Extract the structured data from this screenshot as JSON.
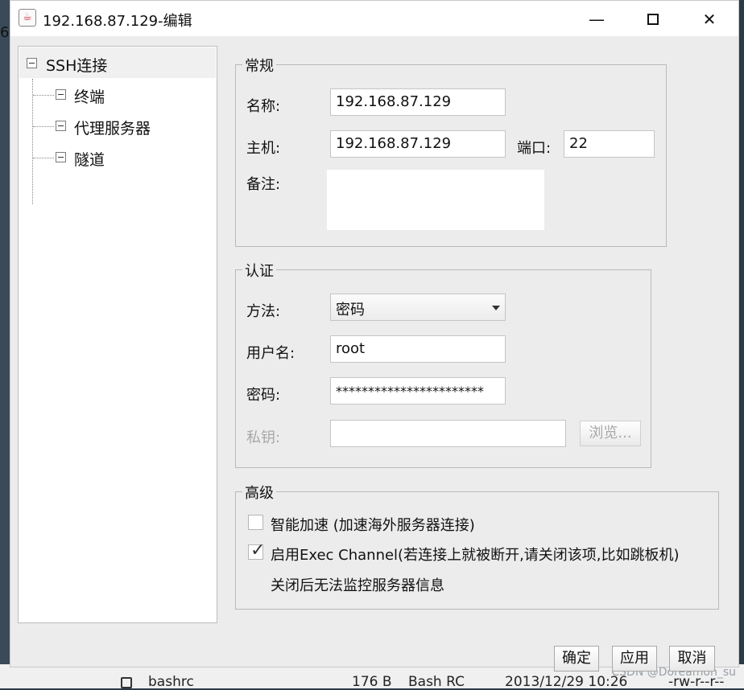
{
  "window": {
    "title": "192.168.87.129-编辑"
  },
  "tree": {
    "root": "SSH连接",
    "children": [
      "终端",
      "代理服务器",
      "隧道"
    ]
  },
  "general": {
    "title": "常规",
    "name_label": "名称:",
    "name_value": "192.168.87.129",
    "host_label": "主机:",
    "host_value": "192.168.87.129",
    "port_label": "端口:",
    "port_value": "22",
    "note_label": "备注:",
    "note_value": ""
  },
  "auth": {
    "title": "认证",
    "method_label": "方法:",
    "method_value": "密码",
    "user_label": "用户名:",
    "user_value": "root",
    "password_label": "密码:",
    "password_value": "***********************",
    "key_label": "私钥:",
    "key_value": "",
    "browse_label": "浏览..."
  },
  "advanced": {
    "title": "高级",
    "accel_label": "智能加速 (加速海外服务器连接)",
    "accel_checked": false,
    "exec_label": "启用Exec Channel(若连接上就被断开,请关闭该项,比如跳板机)",
    "exec_checked": true,
    "exec_note": "关闭后无法监控服务器信息"
  },
  "buttons": {
    "ok": "确定",
    "apply": "应用",
    "cancel": "取消"
  },
  "background": {
    "left_digit": "6",
    "file_name": "bashrc",
    "file_size": "176 B",
    "file_type": "Bash RC",
    "file_date": "2013/12/29 10:26",
    "file_perm": "-rw-r--r--",
    "watermark": "CSDN @Doreamon_su"
  }
}
